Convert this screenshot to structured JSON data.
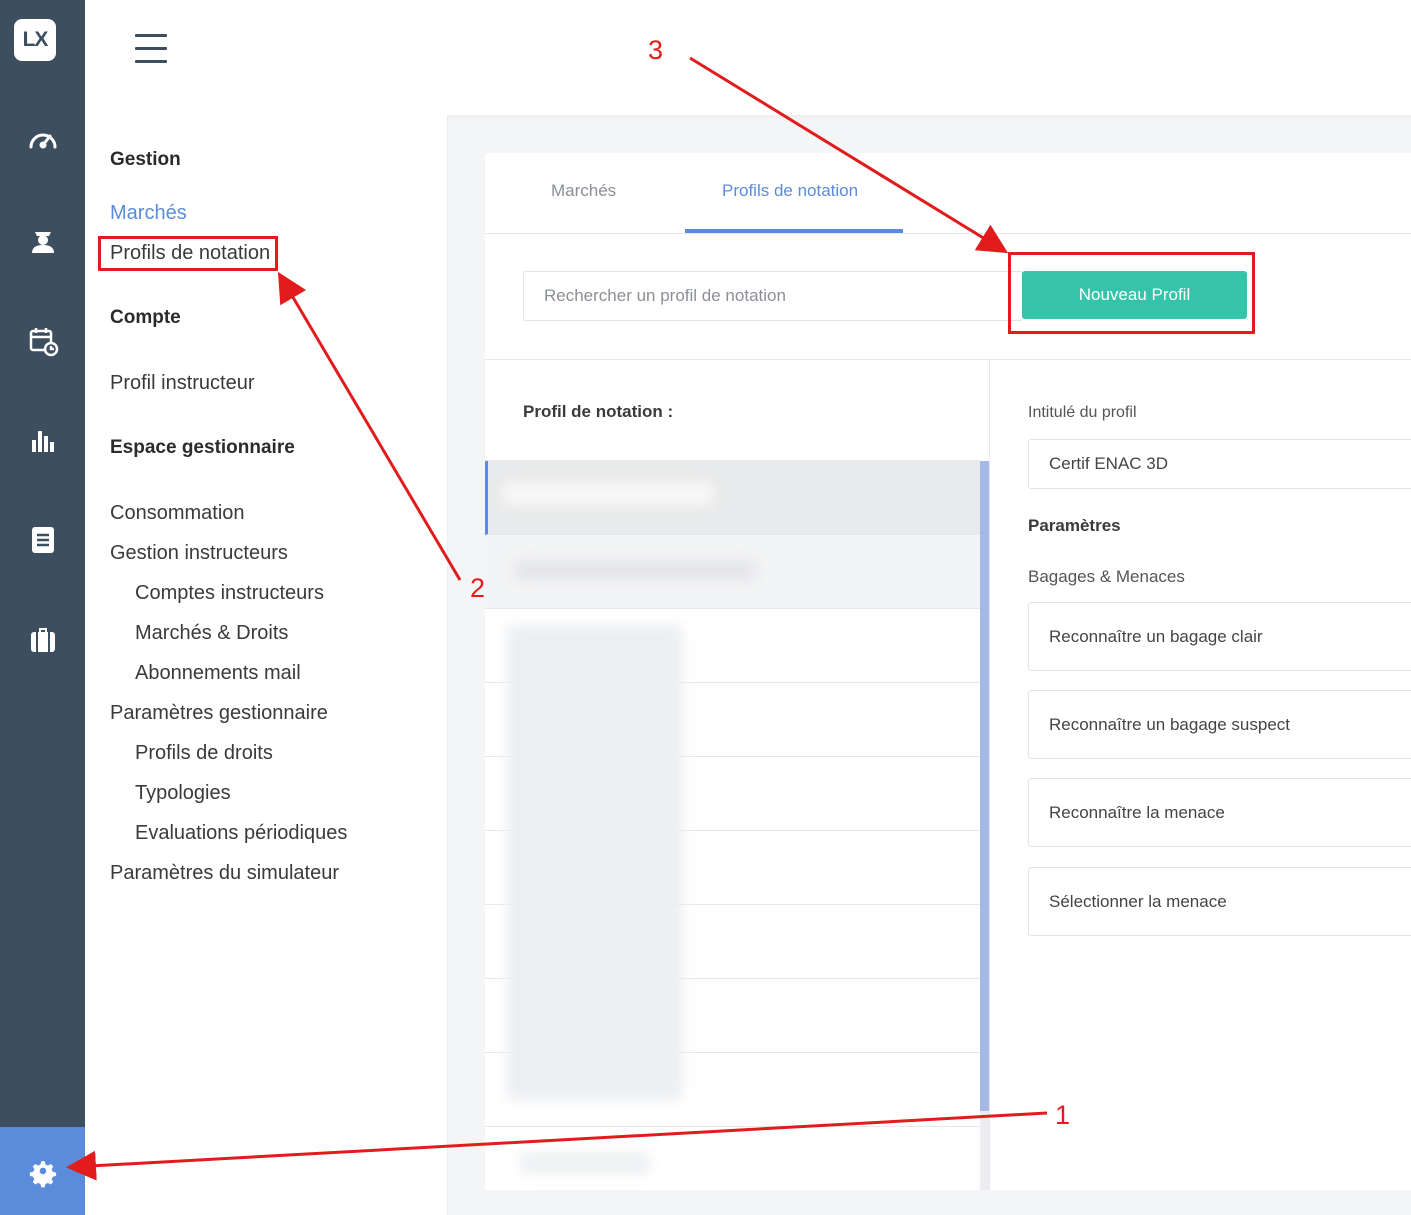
{
  "app": {
    "logo": "LX"
  },
  "rail": {
    "icons": [
      "speedometer-icon",
      "user-badge-icon",
      "calendar-clock-icon",
      "bar-chart-icon",
      "document-list-icon",
      "briefcase-icon",
      "gear-icon"
    ]
  },
  "submenu": {
    "gestion_heading": "Gestion",
    "marches": "Marchés",
    "profils_notation": "Profils de notation",
    "compte_heading": "Compte",
    "profil_instructeur": "Profil instructeur",
    "espace_heading": "Espace gestionnaire",
    "consommation": "Consommation",
    "gestion_instructeurs": "Gestion instructeurs",
    "comptes_instructeurs": "Comptes instructeurs",
    "marches_droits": "Marchés & Droits",
    "abonnements_mail": "Abonnements mail",
    "parametres_gestionnaire": "Paramètres gestionnaire",
    "profils_droits": "Profils de droits",
    "typologies": "Typologies",
    "evaluations": "Evaluations périodiques",
    "parametres_simulateur": "Paramètres du simulateur"
  },
  "tabs": {
    "marches": "Marchés",
    "profils": "Profils de notation"
  },
  "search": {
    "placeholder": "Rechercher un profil de notation"
  },
  "new_button": "Nouveau Profil",
  "list": {
    "title": "Profil de notation :"
  },
  "details": {
    "intitule_label": "Intitulé du profil",
    "intitule_value": "Certif ENAC 3D",
    "parametres_heading": "Paramètres",
    "section_label": "Bagages & Menaces",
    "items": [
      "Reconnaître un bagage clair",
      "Reconnaître un bagage suspect",
      "Reconnaître la menace",
      "Sélectionner la menace"
    ]
  },
  "annotations": {
    "n1": "1",
    "n2": "2",
    "n3": "3"
  },
  "colors": {
    "accent": "#5b8cdb",
    "button": "#35c3aa",
    "rail": "#3d4e5e",
    "annotation": "#e21c1c"
  }
}
